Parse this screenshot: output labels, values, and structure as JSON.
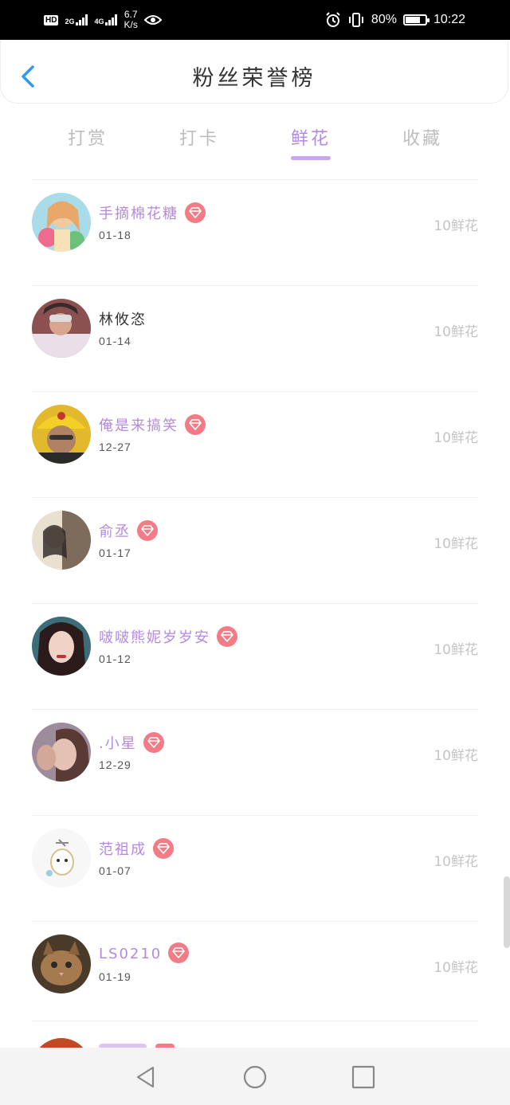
{
  "status_bar": {
    "hd_label": "HD",
    "sim1": "2G",
    "sim2": "4G",
    "net_speed": "6.7",
    "net_speed_unit": "K/s",
    "battery_percent": "80%",
    "battery_level": 0.8,
    "time": "10:22"
  },
  "header": {
    "title": "粉丝荣誉榜"
  },
  "tabs": [
    {
      "label": "打赏"
    },
    {
      "label": "打卡"
    },
    {
      "label": "鲜花"
    },
    {
      "label": "收藏"
    }
  ],
  "active_tab": "鲜花",
  "list": [
    {
      "name": "手摘棉花糖",
      "date": "01-18",
      "count": "10鲜花",
      "vip": true
    },
    {
      "name": "林攸恣",
      "date": "01-14",
      "count": "10鲜花",
      "vip": false
    },
    {
      "name": "俺是来搞笑",
      "date": "12-27",
      "count": "10鲜花",
      "vip": true
    },
    {
      "name": "俞丞",
      "date": "01-17",
      "count": "10鲜花",
      "vip": true
    },
    {
      "name": "啵啵熊妮岁岁安",
      "date": "01-12",
      "count": "10鲜花",
      "vip": true
    },
    {
      "name": ".小星",
      "date": "12-29",
      "count": "10鲜花",
      "vip": true
    },
    {
      "name": "范祖成",
      "date": "01-07",
      "count": "10鲜花",
      "vip": true
    },
    {
      "name": "LS0210",
      "date": "01-19",
      "count": "10鲜花",
      "vip": true
    }
  ],
  "colors": {
    "accent": "#b48ae0",
    "badge": "#f27b85",
    "back_arrow": "#2f9bf0"
  },
  "icons": {
    "back": "chevron-left-icon",
    "vip": "diamond-icon",
    "nav_back": "triangle-back-icon",
    "nav_home": "circle-home-icon",
    "nav_recent": "square-recent-icon"
  }
}
